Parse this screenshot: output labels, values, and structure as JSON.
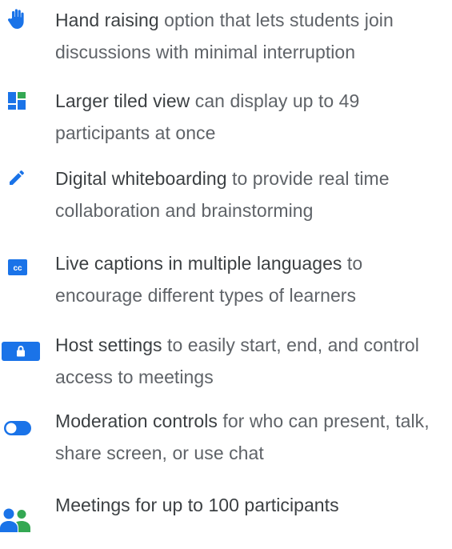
{
  "colors": {
    "accent": "#1a73e8",
    "title_text": "#3c4043",
    "body_text": "#5f6368"
  },
  "features": [
    {
      "icon": "raised-hand-icon",
      "title": "Hand raising",
      "text": " option that lets students join discussions with minimal interruption"
    },
    {
      "icon": "tiled-view-icon",
      "title": "Larger tiled view",
      "text": " can display up to 49 participants at once"
    },
    {
      "icon": "pencil-icon",
      "title": "Digital whiteboarding",
      "text": " to provide real time collaboration and brainstorming"
    },
    {
      "icon": "closed-captions-icon",
      "title": "Live captions in multiple languages",
      "text": " to encourage different types of learners"
    },
    {
      "icon": "lock-screen-icon",
      "title": "Host settings",
      "text": " to easily start, end, and control access to meetings"
    },
    {
      "icon": "toggle-icon",
      "title": "Moderation controls",
      "text": " for who can present, talk, share screen, or use chat"
    },
    {
      "icon": "people-icon",
      "title": "",
      "text": "Meetings for up to 100 participants"
    }
  ]
}
